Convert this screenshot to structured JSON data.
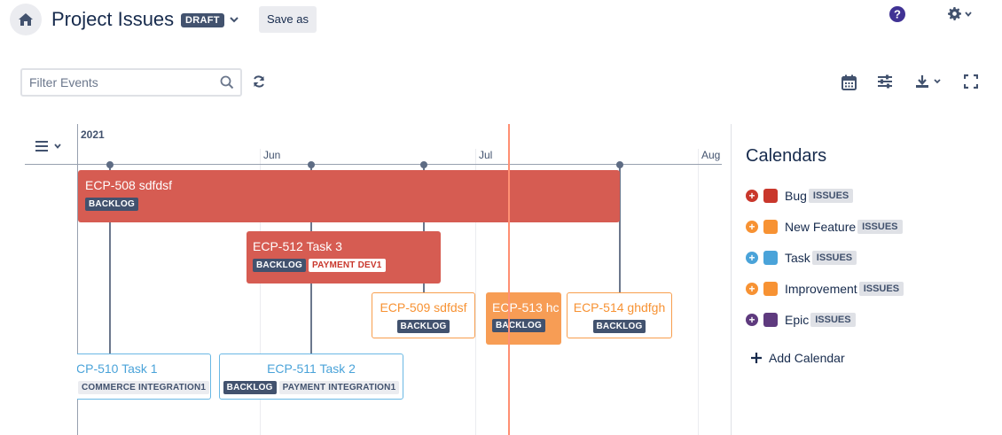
{
  "header": {
    "title": "Project Issues",
    "draft_badge": "DRAFT",
    "save_as_label": "Save as"
  },
  "toolbar": {
    "filter_placeholder": "Filter Events"
  },
  "timeline": {
    "year": "2021",
    "months": [
      "Jun",
      "Jul",
      "Aug"
    ]
  },
  "events": [
    {
      "title": "ECP-508 sdfdsf",
      "tags": [
        "BACKLOG"
      ]
    },
    {
      "title": "ECP-512 Task 3",
      "tags": [
        "BACKLOG",
        "PAYMENT DEV1"
      ]
    },
    {
      "title": "ECP-509 sdfdsf",
      "tags": [
        "BACKLOG"
      ]
    },
    {
      "title": "ECP-513 hc",
      "tags": [
        "BACKLOG"
      ]
    },
    {
      "title": "ECP-514 ghdfgh",
      "tags": [
        "BACKLOG"
      ]
    },
    {
      "title": "CP-510 Task 1",
      "tags": [
        "COMMERCE INTEGRATION1"
      ]
    },
    {
      "title": "ECP-511 Task 2",
      "tags": [
        "BACKLOG",
        "PAYMENT INTEGRATION1"
      ]
    }
  ],
  "sidebar": {
    "title": "Calendars",
    "calendars": [
      {
        "name": "Bug",
        "tag": "ISSUES",
        "color": "#c9372c",
        "plus_color": "#c9372c"
      },
      {
        "name": "New Feature",
        "tag": "ISSUES",
        "color": "#f79233",
        "plus_color": "#f79233"
      },
      {
        "name": "Task",
        "tag": "ISSUES",
        "color": "#4aa3d9",
        "plus_color": "#4aa3d9"
      },
      {
        "name": "Improvement",
        "tag": "ISSUES",
        "color": "#f79233",
        "plus_color": "#f79233"
      },
      {
        "name": "Epic",
        "tag": "ISSUES",
        "color": "#5e3a7e",
        "plus_color": "#5e3a7e"
      }
    ],
    "add_label": "Add Calendar"
  }
}
